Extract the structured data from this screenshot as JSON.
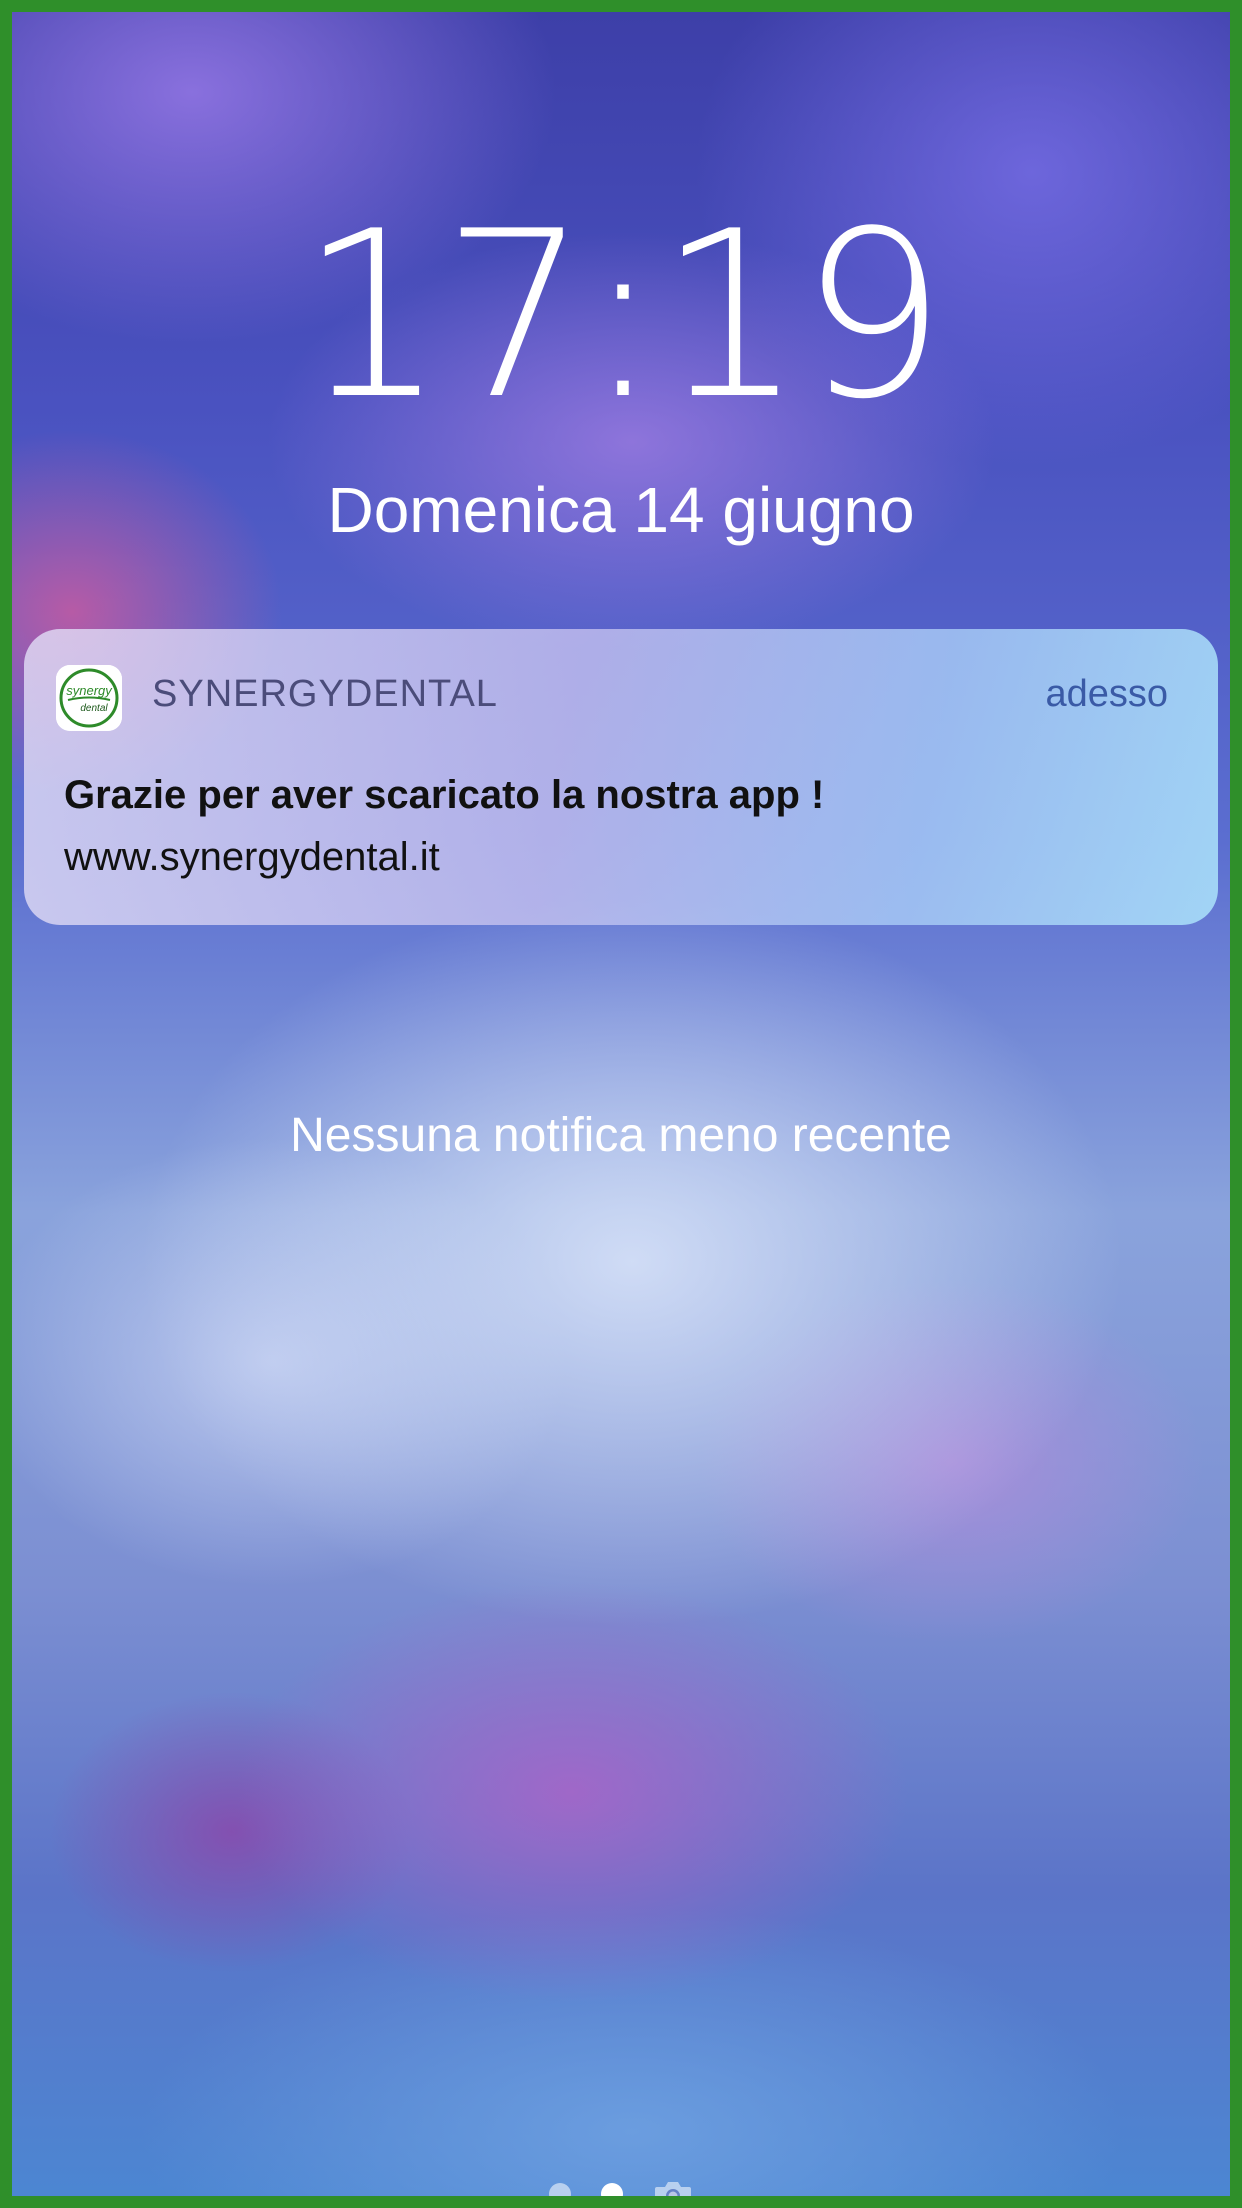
{
  "lockscreen": {
    "time": "17:19",
    "date": "Domenica 14 giugno",
    "empty_message": "Nessuna notifica meno recente"
  },
  "notification": {
    "app_name": "SYNERGYDENTAL",
    "time_label": "adesso",
    "title": "Grazie per aver scaricato la nostra app !",
    "body": "www.synergydental.it",
    "icon": "synergydental-logo-icon",
    "icon_text_1": "synergy",
    "icon_text_2": "dental"
  },
  "pager": {
    "pages": 2,
    "active_index": 1,
    "camera_icon": "camera-icon"
  },
  "colors": {
    "frame": "#2f8f2a",
    "app_name": "#4b4c7a",
    "time_label": "#3a5aa6",
    "logo_green": "#2e8b2a"
  }
}
